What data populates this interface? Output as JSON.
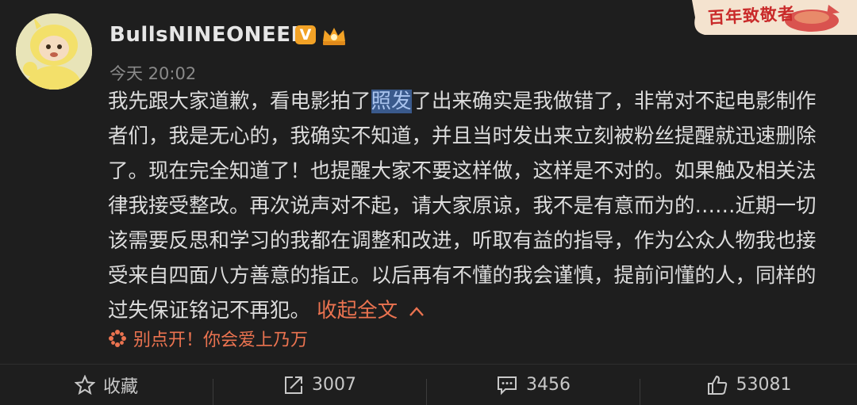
{
  "user": {
    "name": "BullsNINEONEEE",
    "verified_badge": "V"
  },
  "post": {
    "time": "今天 20:02",
    "lines": [
      {
        "pre": "我先跟大家道歉，看电影拍了",
        "highlight": "照发",
        "post": "了出来确实是我做错了，非常对不起电影制作"
      },
      {
        "text": "者们，我是无心的，我确实不知道，并且当时发出来立刻被粉丝提醒就迅速删除"
      },
      {
        "text": "了。现在完全知道了！也提醒大家不要这样做，这样是不对的。如果触及相关法"
      },
      {
        "text": "律我接受整改。再次说声对不起，请大家原谅，我不是有意而为的……近期一切"
      },
      {
        "text": "该需要反思和学习的我都在调整和改进，听取有益的指导，作为公众人物我也接"
      },
      {
        "text": "受来自四面八方善意的指正。以后再有不懂的我会谨慎，提前问懂的人，同样的"
      },
      {
        "text": "过失保证铭记不再犯。",
        "link": "收起全文"
      }
    ],
    "tagline": "别点开！你会爱上乃万"
  },
  "banner": {
    "text": "百年致敬者"
  },
  "actions": {
    "favorite": {
      "label": "收藏"
    },
    "repost": {
      "count": "3007"
    },
    "comment": {
      "count": "3456"
    },
    "like": {
      "count": "53081"
    }
  },
  "colors": {
    "background": "#1e1e1e",
    "accent": "#eb7350",
    "text": "#dcdcdc",
    "muted": "#8a8a8a",
    "badge": "#f2a226"
  }
}
